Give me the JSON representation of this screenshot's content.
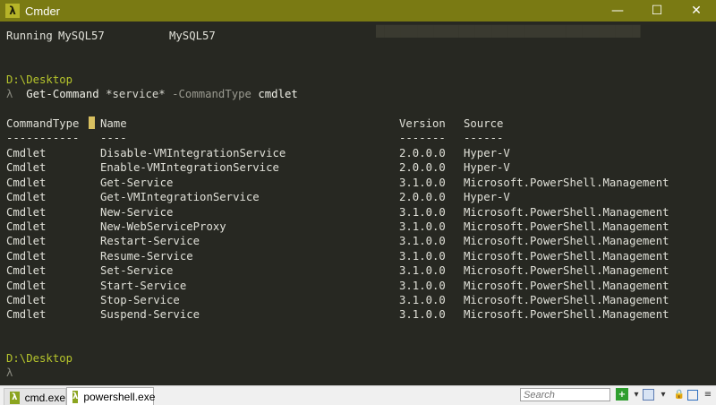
{
  "window": {
    "title": "Cmder"
  },
  "titlebar": {
    "minimize": "—",
    "maximize": "☐",
    "close": "✕"
  },
  "console": {
    "running_line": {
      "status": "Running",
      "name": "MySQL57",
      "display": "MySQL57"
    },
    "prompt1": {
      "path": "D:\\Desktop",
      "lambda": "λ",
      "command": "Get-Command",
      "arg": "*service*",
      "param": "-CommandType",
      "value": "cmdlet"
    },
    "table": {
      "headers": [
        "CommandType",
        "Name",
        "Version",
        "Source"
      ],
      "underlines": [
        "-----------",
        "----",
        "-------",
        "------"
      ],
      "rows": [
        [
          "Cmdlet",
          "Disable-VMIntegrationService",
          "2.0.0.0",
          "Hyper-V"
        ],
        [
          "Cmdlet",
          "Enable-VMIntegrationService",
          "2.0.0.0",
          "Hyper-V"
        ],
        [
          "Cmdlet",
          "Get-Service",
          "3.1.0.0",
          "Microsoft.PowerShell.Management"
        ],
        [
          "Cmdlet",
          "Get-VMIntegrationService",
          "2.0.0.0",
          "Hyper-V"
        ],
        [
          "Cmdlet",
          "New-Service",
          "3.1.0.0",
          "Microsoft.PowerShell.Management"
        ],
        [
          "Cmdlet",
          "New-WebServiceProxy",
          "3.1.0.0",
          "Microsoft.PowerShell.Management"
        ],
        [
          "Cmdlet",
          "Restart-Service",
          "3.1.0.0",
          "Microsoft.PowerShell.Management"
        ],
        [
          "Cmdlet",
          "Resume-Service",
          "3.1.0.0",
          "Microsoft.PowerShell.Management"
        ],
        [
          "Cmdlet",
          "Set-Service",
          "3.1.0.0",
          "Microsoft.PowerShell.Management"
        ],
        [
          "Cmdlet",
          "Start-Service",
          "3.1.0.0",
          "Microsoft.PowerShell.Management"
        ],
        [
          "Cmdlet",
          "Stop-Service",
          "3.1.0.0",
          "Microsoft.PowerShell.Management"
        ],
        [
          "Cmdlet",
          "Suspend-Service",
          "3.1.0.0",
          "Microsoft.PowerShell.Management"
        ]
      ]
    },
    "prompt2": {
      "path": "D:\\Desktop",
      "lambda": "λ"
    }
  },
  "tabs": [
    {
      "label": "cmd.exe",
      "icon": "lambda-icon"
    },
    {
      "label": "powershell.exe",
      "icon": "lambda-icon"
    }
  ],
  "statusbar": {
    "search_placeholder": "Search"
  },
  "colors": {
    "titlebar": "#7a7a13",
    "background": "#272822",
    "path": "#b5c42c"
  }
}
